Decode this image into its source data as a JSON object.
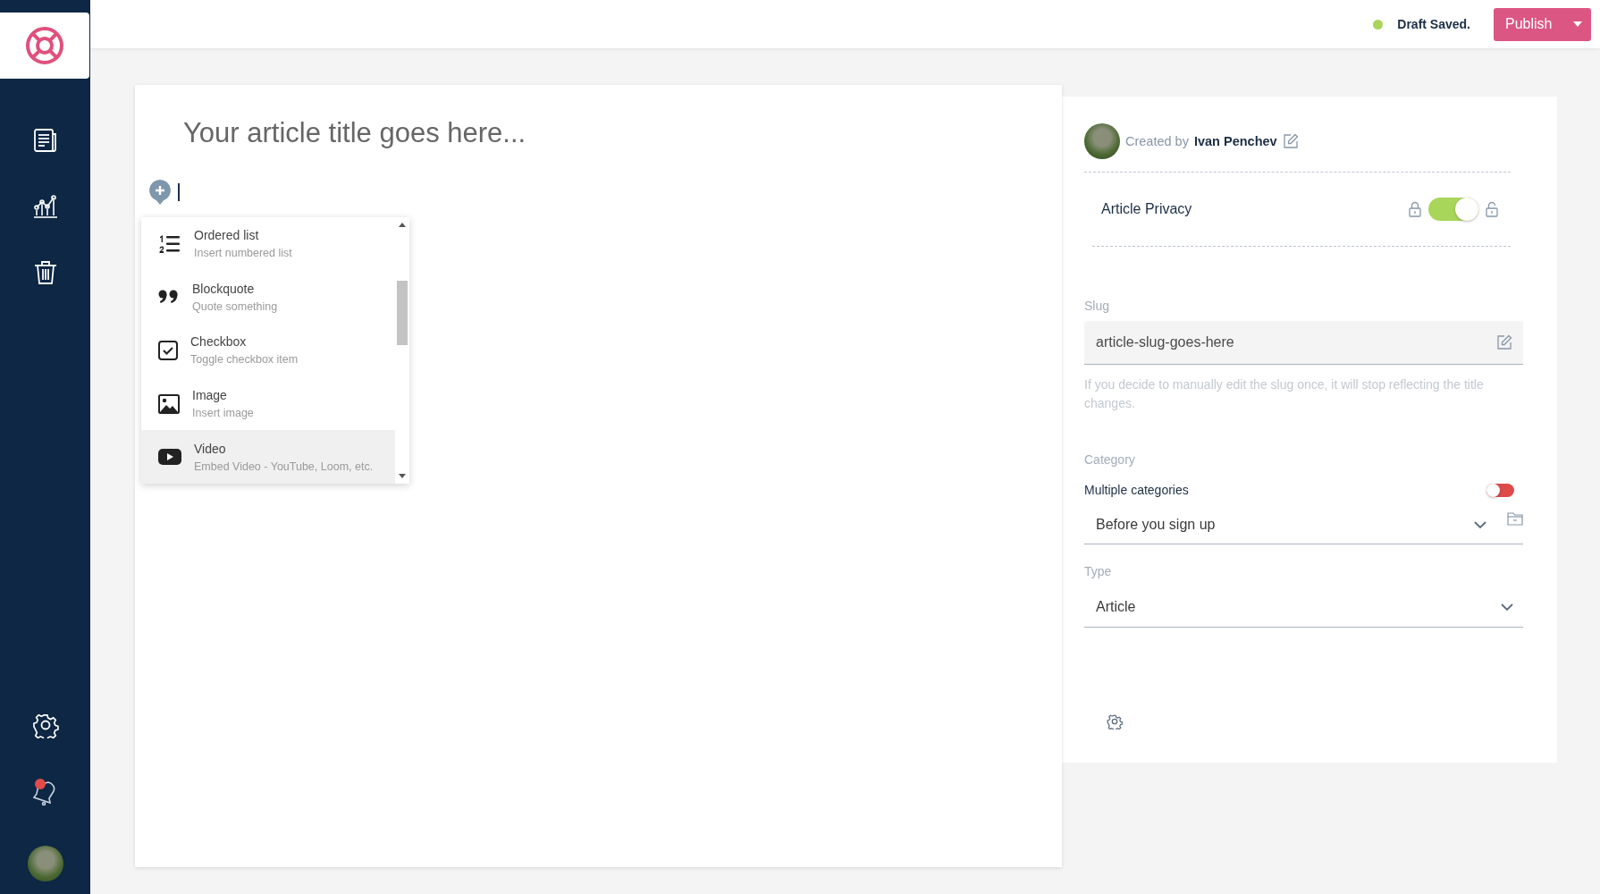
{
  "top_bar": {
    "status": "Draft Saved.",
    "publish_button": "Publish"
  },
  "editor": {
    "title_placeholder": "Your article title goes here...",
    "block_menu": [
      {
        "kind": "ordered-list",
        "label": "Ordered list",
        "description": "Insert numbered list",
        "selected": false
      },
      {
        "kind": "blockquote",
        "label": "Blockquote",
        "description": "Quote something",
        "selected": false
      },
      {
        "kind": "checkbox",
        "label": "Checkbox",
        "description": "Toggle checkbox item",
        "selected": false
      },
      {
        "kind": "image",
        "label": "Image",
        "description": "Insert image",
        "selected": false
      },
      {
        "kind": "video",
        "label": "Video",
        "description": "Embed Video - YouTube, Loom, etc.",
        "selected": true
      }
    ]
  },
  "settings_panel": {
    "created_by_label": "Created by",
    "author": "Ivan Penchev",
    "privacy": {
      "label": "Article Privacy",
      "on": true
    },
    "slug": {
      "label": "Slug",
      "value": "article-slug-goes-here",
      "hint": "If you decide to manually edit the slug once, it will stop reflecting the title changes."
    },
    "category": {
      "label": "Category",
      "multiple_label": "Multiple categories",
      "multiple_on": false,
      "value": "Before you sign up"
    },
    "type": {
      "label": "Type",
      "value": "Article"
    }
  }
}
